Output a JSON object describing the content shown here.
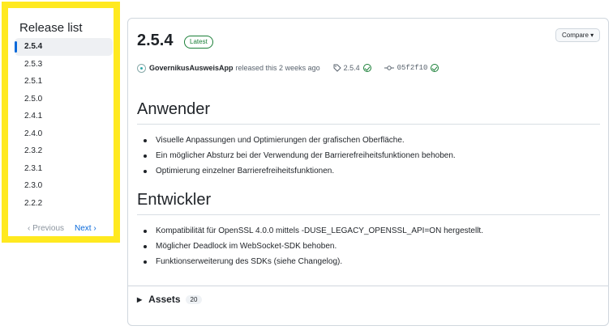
{
  "sidebar": {
    "title": "Release list",
    "items": [
      {
        "label": "2.5.4",
        "active": true
      },
      {
        "label": "2.5.3"
      },
      {
        "label": "2.5.1"
      },
      {
        "label": "2.5.0"
      },
      {
        "label": "2.4.1"
      },
      {
        "label": "2.4.0"
      },
      {
        "label": "2.3.2"
      },
      {
        "label": "2.3.1"
      },
      {
        "label": "2.3.0"
      },
      {
        "label": "2.2.2"
      }
    ],
    "prev_label": "Previous",
    "next_label": "Next"
  },
  "release": {
    "version": "2.5.4",
    "badge": "Latest",
    "compare_label": "Compare",
    "author": "GovernikusAusweisApp",
    "released_text": "released this 2 weeks ago",
    "tag": "2.5.4",
    "commit": "05f2f10"
  },
  "sections": [
    {
      "heading": "Anwender",
      "items": [
        "Visuelle Anpassungen und Optimierungen der grafischen Oberfläche.",
        "Ein möglicher Absturz bei der Verwendung der Barrierefreiheitsfunktionen behoben.",
        "Optimierung einzelner Barrierefreiheitsfunktionen."
      ]
    },
    {
      "heading": "Entwickler",
      "items": [
        "Kompatibilität für OpenSSL 4.0.0 mittels -DUSE_LEGACY_OPENSSL_API=ON hergestellt.",
        "Möglicher Deadlock im WebSocket-SDK behoben.",
        "Funktionserweiterung des SDKs (siehe Changelog)."
      ]
    }
  ],
  "assets": {
    "label": "Assets",
    "count": "20"
  },
  "colors": {
    "highlight_border": "#ffe91f",
    "link": "#0969da",
    "success": "#1a7f37"
  }
}
